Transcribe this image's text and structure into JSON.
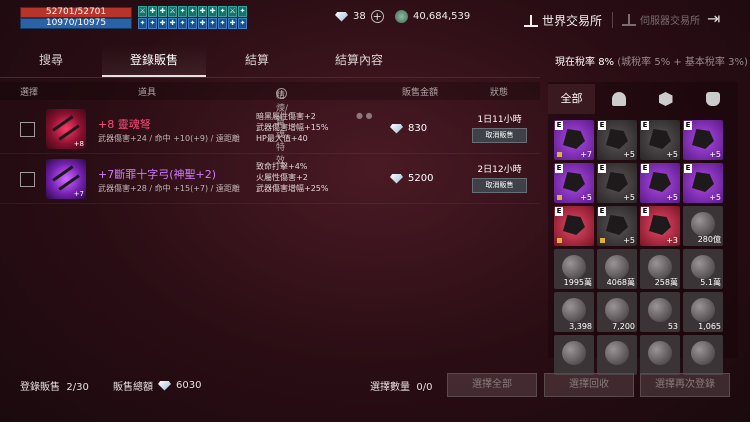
{
  "hud": {
    "hp": "52701/52701",
    "mp": "10970/10975",
    "buffs": [
      "⚔",
      "✚",
      "✚",
      "⚔",
      "✦",
      "✦",
      "✚",
      "✚",
      "✦",
      "⚔",
      "✦",
      "✦",
      "✦",
      "✚",
      "✚",
      "✦",
      "✦",
      "✚",
      "✦",
      "✦",
      "✚",
      "✦"
    ]
  },
  "currency": {
    "diamonds": "38",
    "silver": "40,684,539"
  },
  "header": {
    "world_exchange": "世界交易所",
    "server_exchange": "伺服器交易所"
  },
  "tabs": [
    "搜尋",
    "登錄販售",
    "結算",
    "結算內容"
  ],
  "tax": {
    "label": "現在稅率",
    "rate": "8%",
    "detail": "(城稅率 5% + 基本稅率 3%)"
  },
  "table_headers": {
    "select": "選擇",
    "item": "道具",
    "effects": "精煉/靈魂特效",
    "price": "販售金額",
    "status": "狀態"
  },
  "listings": [
    {
      "name": "+8 靈魂弩",
      "stat": "武器傷害+24 / 命中 +10(+9) / 遠距離",
      "effects": [
        "暗黑屬性傷害+2",
        "武器傷害增幅+15%",
        "HP最大值+40"
      ],
      "price": "830",
      "time": "1日11小時",
      "cancel": "取消販售",
      "enh": "+8",
      "rarity": "red"
    },
    {
      "name": "+7斷罪十字弓(神聖+2)",
      "stat": "武器傷害+28 / 命中 +15(+7) / 遠距離",
      "effects": [
        "致命打擊+4%",
        "火屬性傷害+2",
        "武器傷害增幅+25%"
      ],
      "price": "5200",
      "time": "2日12小時",
      "cancel": "取消販售",
      "enh": "+7",
      "rarity": "purple"
    }
  ],
  "inventory_tabs": {
    "all": "全部"
  },
  "inventory": [
    {
      "type": "purple",
      "e": "E",
      "count": "+7",
      "lock": true
    },
    {
      "type": "dark",
      "e": "E",
      "count": "+5",
      "lock": false
    },
    {
      "type": "dark",
      "e": "E",
      "count": "+5",
      "lock": false
    },
    {
      "type": "purple",
      "e": "E",
      "count": "+5",
      "lock": false
    },
    {
      "type": "purple",
      "e": "E",
      "count": "+5",
      "lock": true
    },
    {
      "type": "dark",
      "e": "E",
      "count": "+5",
      "lock": false
    },
    {
      "type": "purple",
      "e": "E",
      "count": "+5",
      "lock": false
    },
    {
      "type": "purple",
      "e": "E",
      "count": "+5",
      "lock": false
    },
    {
      "type": "redc",
      "e": "E",
      "count": "",
      "lock": true
    },
    {
      "type": "dark",
      "e": "E",
      "count": "+5",
      "lock": true
    },
    {
      "type": "redc",
      "e": "E",
      "count": "+3",
      "lock": false
    },
    {
      "type": "ore",
      "e": "",
      "count": "280億",
      "lock": false
    },
    {
      "type": "ore",
      "e": "",
      "count": "1995萬",
      "lock": false
    },
    {
      "type": "ore",
      "e": "",
      "count": "4068萬",
      "lock": false
    },
    {
      "type": "ore",
      "e": "",
      "count": "258萬",
      "lock": false
    },
    {
      "type": "ore",
      "e": "",
      "count": "5.1萬",
      "lock": false
    },
    {
      "type": "ore",
      "e": "",
      "count": "3,398",
      "lock": false
    },
    {
      "type": "ore",
      "e": "",
      "count": "7,200",
      "lock": false
    },
    {
      "type": "ore",
      "e": "",
      "count": "53",
      "lock": false
    },
    {
      "type": "ore",
      "e": "",
      "count": "1,065",
      "lock": false
    },
    {
      "type": "ore",
      "e": "",
      "count": "",
      "lock": false
    },
    {
      "type": "ore",
      "e": "",
      "count": "",
      "lock": false
    },
    {
      "type": "ore",
      "e": "",
      "count": "",
      "lock": false
    },
    {
      "type": "ore",
      "e": "",
      "count": "",
      "lock": false
    }
  ],
  "footer": {
    "listed_label": "登錄販售",
    "listed_value": "2/30",
    "total_label": "販售總額",
    "total_value": "6030",
    "selected_label": "選擇數量",
    "selected_value": "0/0",
    "btn_select_all": "選擇全部",
    "btn_reclaim": "選擇回收",
    "btn_relist": "選擇再次登錄"
  }
}
